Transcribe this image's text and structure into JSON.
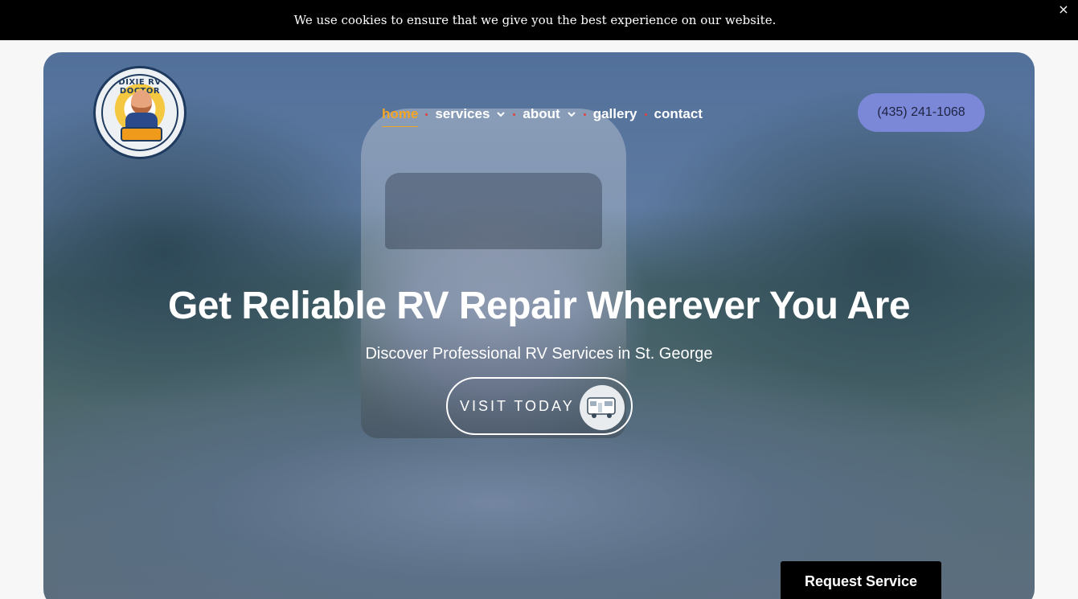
{
  "cookie": {
    "message": "We use cookies to ensure that we give you the best experience on our website.",
    "close_label": "×"
  },
  "logo": {
    "text": "DIXIE RV DOCTOR"
  },
  "nav": {
    "items": [
      {
        "label": "home",
        "active": true,
        "dropdown": false
      },
      {
        "label": "services",
        "active": false,
        "dropdown": true
      },
      {
        "label": "about",
        "active": false,
        "dropdown": true
      },
      {
        "label": "gallery",
        "active": false,
        "dropdown": false
      },
      {
        "label": "contact",
        "active": false,
        "dropdown": false
      }
    ],
    "active_color": "#f5a524",
    "separator_color": "#e3413b"
  },
  "phone": {
    "label": "(435) 241-1068",
    "bg_color": "#7b88d8"
  },
  "hero": {
    "headline": "Get Reliable RV Repair Wherever You Are",
    "subhead": "Discover Professional RV Services in St. George",
    "cta_label": "VISIT TODAY",
    "cta_icon": "rv-icon"
  },
  "request": {
    "label": "Request Service"
  }
}
